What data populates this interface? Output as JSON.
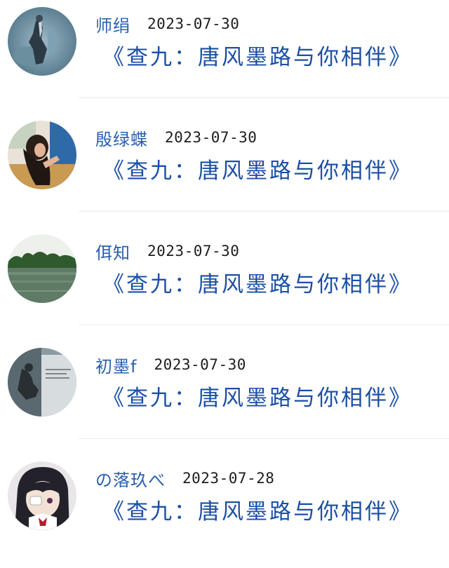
{
  "comments": [
    {
      "username": "师绢",
      "date": "2023-07-30",
      "title": "《查九：唐风墨路与你相伴》",
      "avatar_icon": "figure-sculpture-avatar"
    },
    {
      "username": "殷绿蝶",
      "date": "2023-07-30",
      "title": "《查九：唐风墨路与你相伴》",
      "avatar_icon": "girl-photo-avatar"
    },
    {
      "username": "佴知",
      "date": "2023-07-30",
      "title": "《查九：唐风墨路与你相伴》",
      "avatar_icon": "lake-landscape-avatar"
    },
    {
      "username": "初墨f",
      "date": "2023-07-30",
      "title": "《查九：唐风墨路与你相伴》",
      "avatar_icon": "museum-exhibit-avatar"
    },
    {
      "username": "の落玖べ",
      "date": "2023-07-28",
      "title": "《查九：唐风墨路与你相伴》",
      "avatar_icon": "anime-girl-avatar"
    }
  ]
}
